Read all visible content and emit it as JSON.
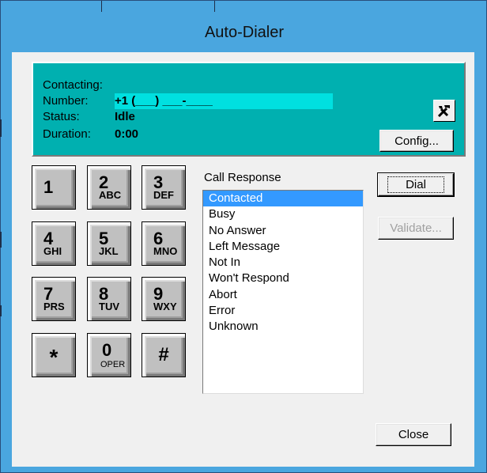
{
  "window": {
    "title": "Auto-Dialer"
  },
  "info_panel": {
    "contacting_label": "Contacting:",
    "number_label": "Number:",
    "number_value": "+1 (___) ___-____",
    "status_label": "Status:",
    "status_value": "Idle",
    "duration_label": "Duration:",
    "duration_value": "0:00",
    "config_label": "Config...",
    "tools_icon": "wrench-hammer-icon"
  },
  "keypad": {
    "keys": [
      {
        "digit": "1",
        "letters": ""
      },
      {
        "digit": "2",
        "letters": "ABC"
      },
      {
        "digit": "3",
        "letters": "DEF"
      },
      {
        "digit": "4",
        "letters": "GHI"
      },
      {
        "digit": "5",
        "letters": "JKL"
      },
      {
        "digit": "6",
        "letters": "MNO"
      },
      {
        "digit": "7",
        "letters": "PRS"
      },
      {
        "digit": "8",
        "letters": "TUV"
      },
      {
        "digit": "9",
        "letters": "WXY"
      },
      {
        "digit": "*",
        "letters": ""
      },
      {
        "digit": "0",
        "letters": "OPER"
      },
      {
        "digit": "#",
        "letters": ""
      }
    ]
  },
  "call_response": {
    "label": "Call Response",
    "items": [
      "Contacted",
      "Busy",
      "No Answer",
      "Left Message",
      "Not In",
      "Won't Respond",
      "Abort",
      "Error",
      "Unknown"
    ],
    "selected": "Contacted"
  },
  "buttons": {
    "dial": "Dial",
    "validate": "Validate...",
    "close": "Close"
  },
  "colors": {
    "title_bar": "#4aa6df",
    "info_panel": "#00b0b0",
    "number_field": "#00e0e0",
    "selection": "#3399ff"
  }
}
